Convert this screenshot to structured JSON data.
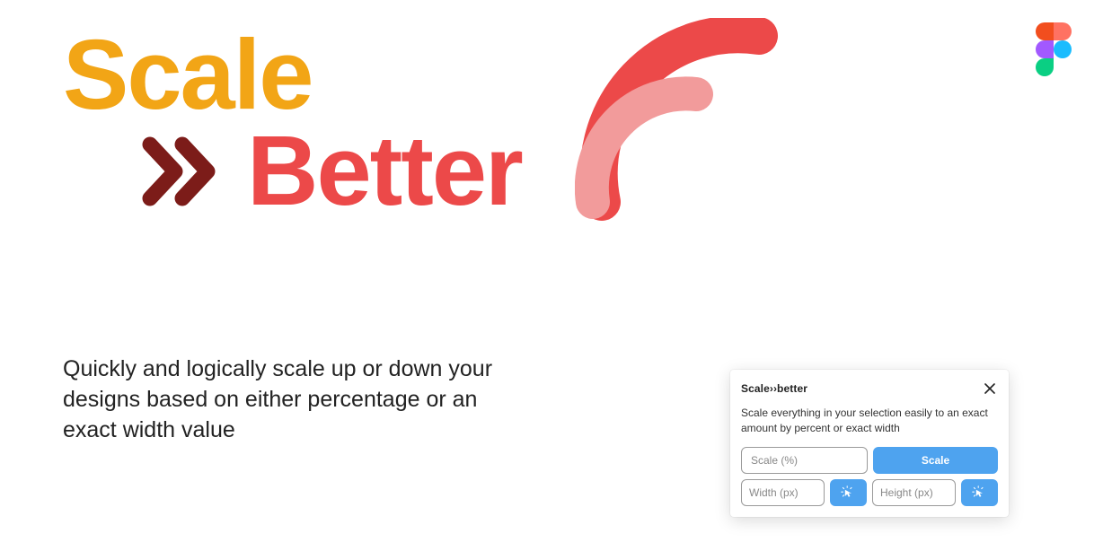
{
  "hero": {
    "title1": "Scale",
    "title2": "Better"
  },
  "description": "Quickly and logically scale up or down your designs based on either percentage or an exact width value",
  "colors": {
    "orange": "#f2a516",
    "red": "#ec4949",
    "darkred": "#7c1c19",
    "lightred": "#f29b9b",
    "blue": "#4ea3ef"
  },
  "panel": {
    "title": "Scale››better",
    "description": "Scale everything in your selection easily to an exact amount by percent or exact width",
    "scale_placeholder": "Scale (%)",
    "scale_button": "Scale",
    "width_placeholder": "Width (px)",
    "height_placeholder": "Height (px)"
  }
}
